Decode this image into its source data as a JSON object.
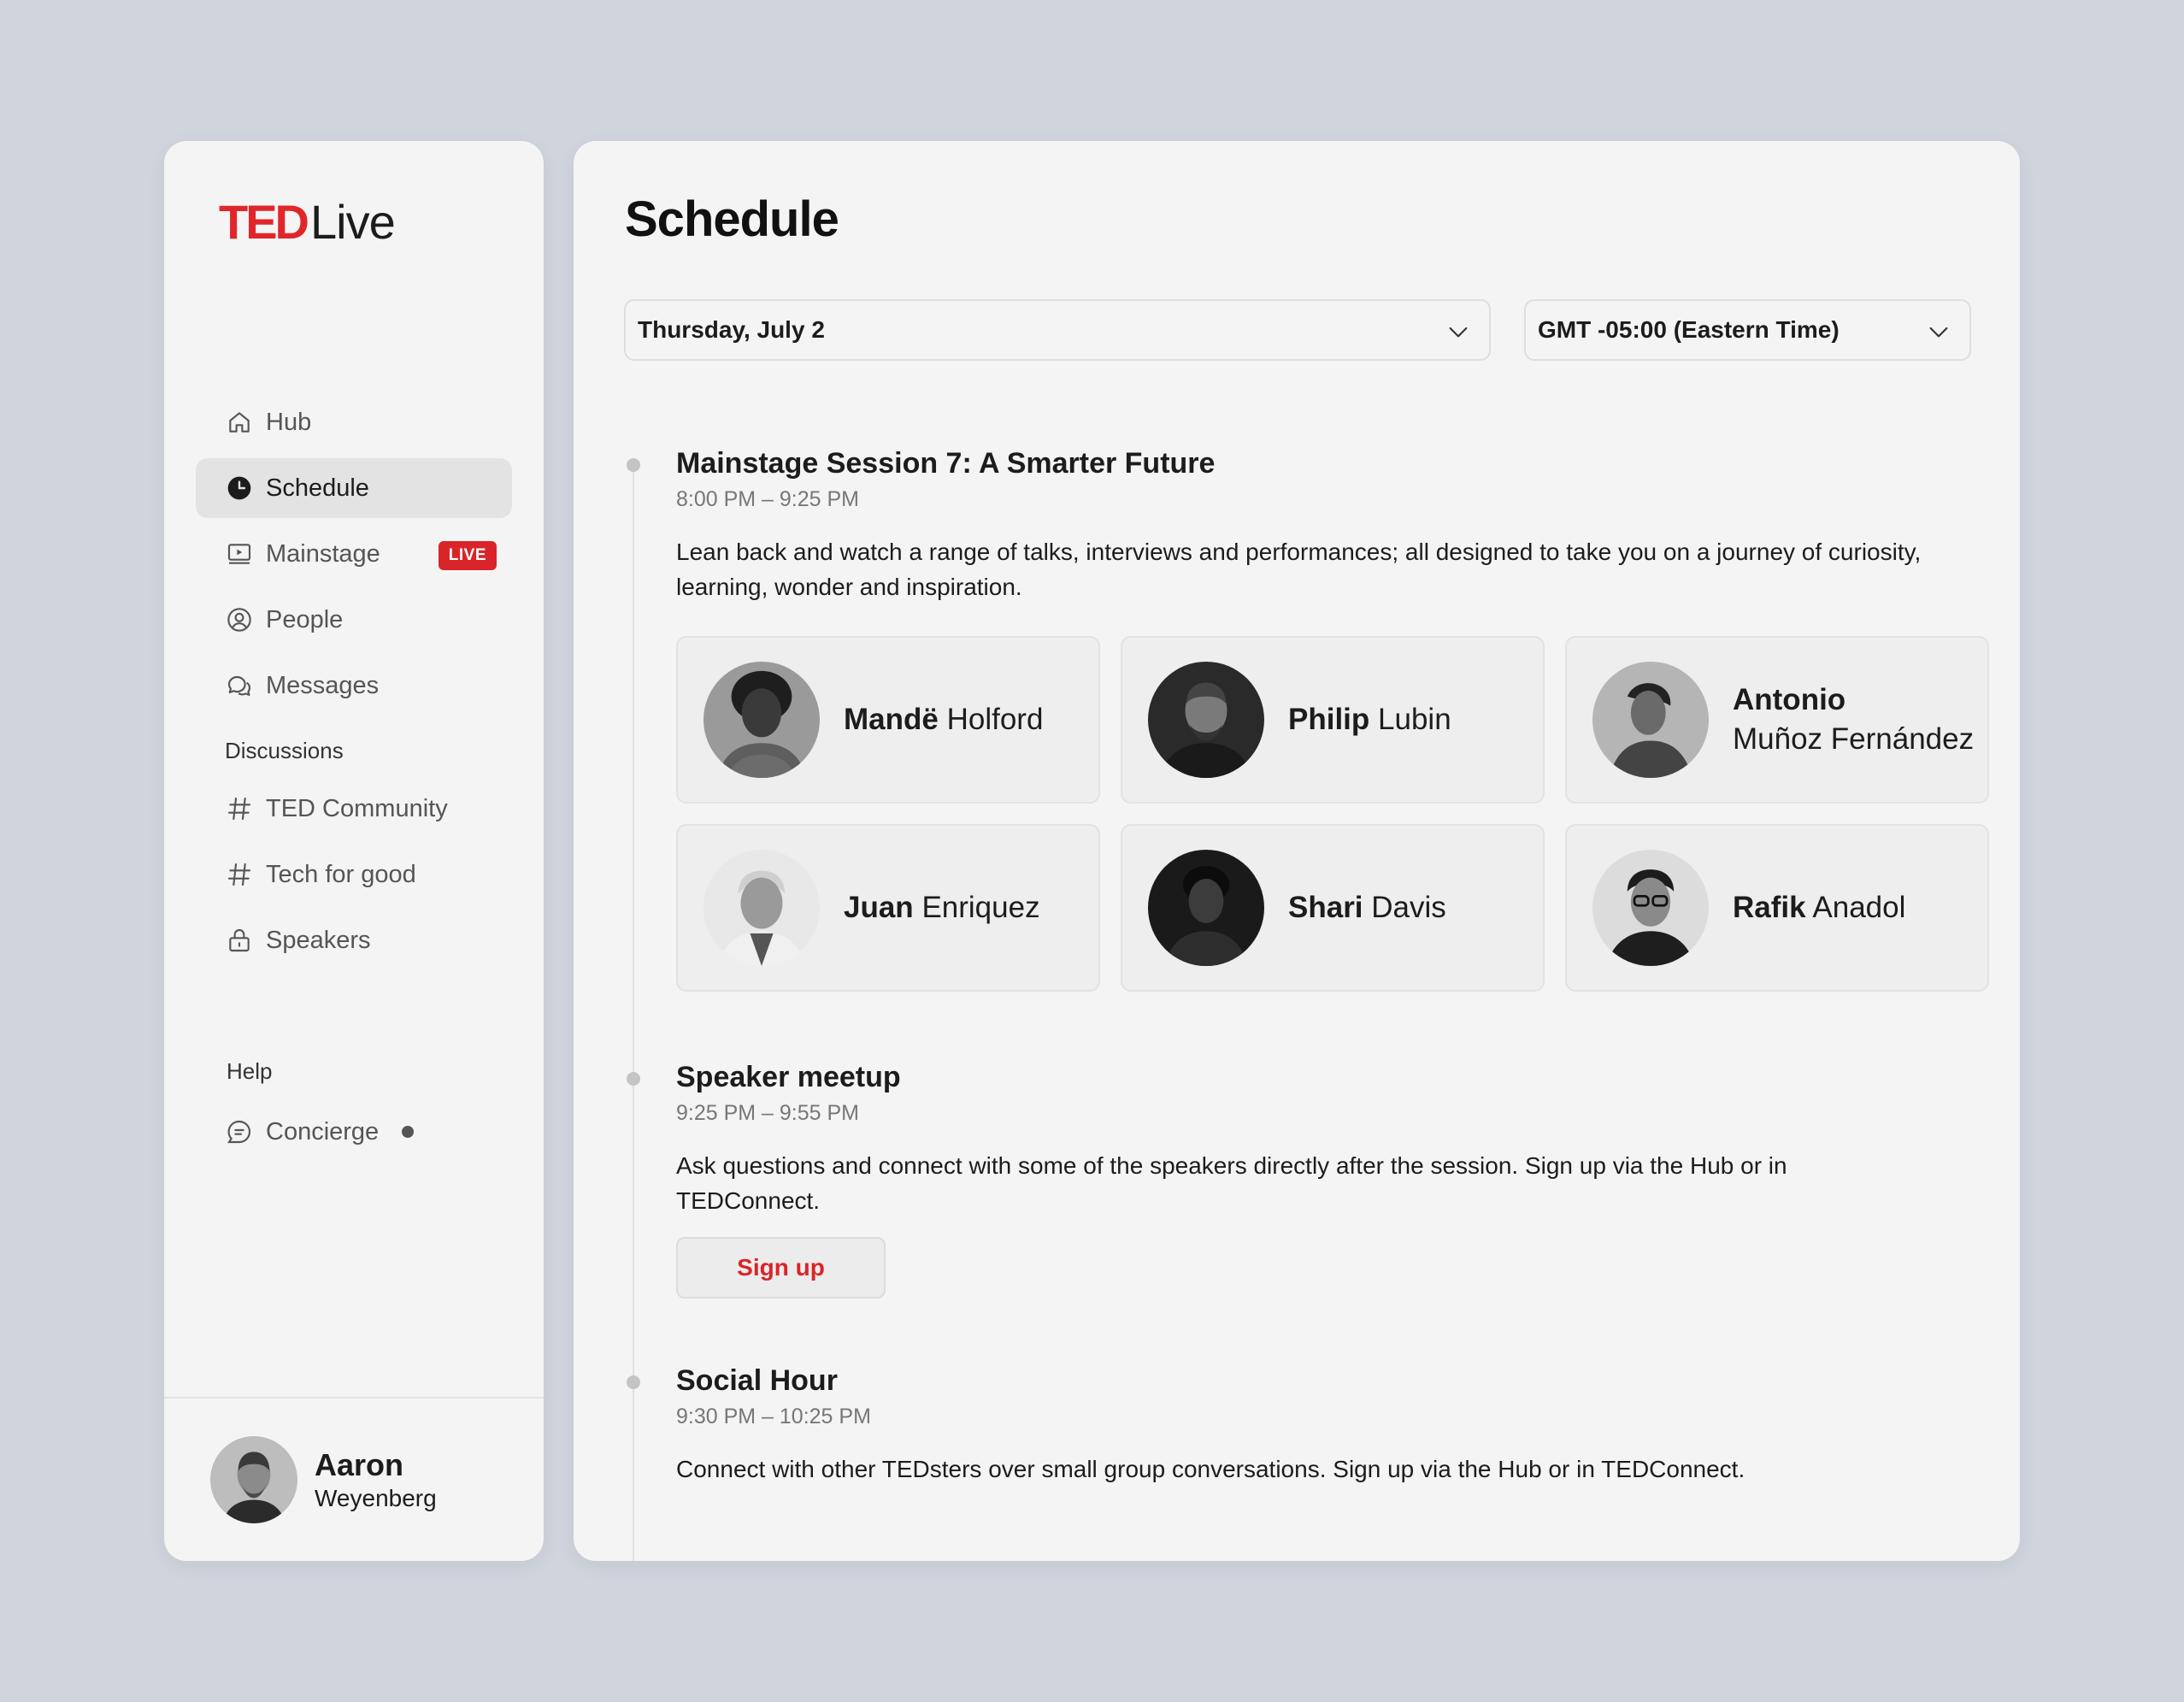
{
  "brand": {
    "ted": "TED",
    "live": "Live",
    "accent": "#e0262b"
  },
  "nav": {
    "items": [
      {
        "label": "Hub",
        "icon": "home-icon"
      },
      {
        "label": "Schedule",
        "icon": "clock-icon",
        "active": true
      },
      {
        "label": "Mainstage",
        "icon": "play-screen-icon",
        "badge": "LIVE"
      },
      {
        "label": "People",
        "icon": "person-circle-icon"
      },
      {
        "label": "Messages",
        "icon": "chat-bubbles-icon"
      }
    ],
    "discussions_label": "Discussions",
    "discussions": [
      {
        "label": "TED Community",
        "icon": "hash-icon"
      },
      {
        "label": "Tech for good",
        "icon": "hash-icon"
      },
      {
        "label": "Speakers",
        "icon": "lock-icon"
      }
    ],
    "help_label": "Help",
    "help": [
      {
        "label": "Concierge",
        "icon": "message-square-icon",
        "indicator": true
      }
    ]
  },
  "user": {
    "first": "Aaron",
    "last": "Weyenberg"
  },
  "main": {
    "title": "Schedule",
    "date_select": "Thursday, July 2",
    "tz_select": "GMT -05:00 (Eastern Time)"
  },
  "events": [
    {
      "title": "Mainstage Session 7: A Smarter Future",
      "time": "8:00 PM – 9:25 PM",
      "description": "Lean back and watch a range of talks, interviews and performances; all designed to take you on a journey of curiosity, learning, wonder and inspiration."
    },
    {
      "title": "Speaker meetup",
      "time": "9:25 PM – 9:55 PM",
      "description": "Ask questions and connect with some of the speakers directly after the session. Sign up via the Hub or in TEDConnect.",
      "button": "Sign up"
    },
    {
      "title": "Social Hour",
      "time": "9:30 PM – 10:25 PM",
      "description": "Connect with other TEDsters over small group conversations. Sign up via the Hub or in TEDConnect."
    }
  ],
  "speakers": [
    {
      "first": "Mandë",
      "last": "Holford"
    },
    {
      "first": "Philip",
      "last": "Lubin"
    },
    {
      "first": "Antonio",
      "last": "Muñoz Fernández"
    },
    {
      "first": "Juan",
      "last": "Enriquez"
    },
    {
      "first": "Shari",
      "last": "Davis"
    },
    {
      "first": "Rafik",
      "last": "Anadol"
    }
  ]
}
